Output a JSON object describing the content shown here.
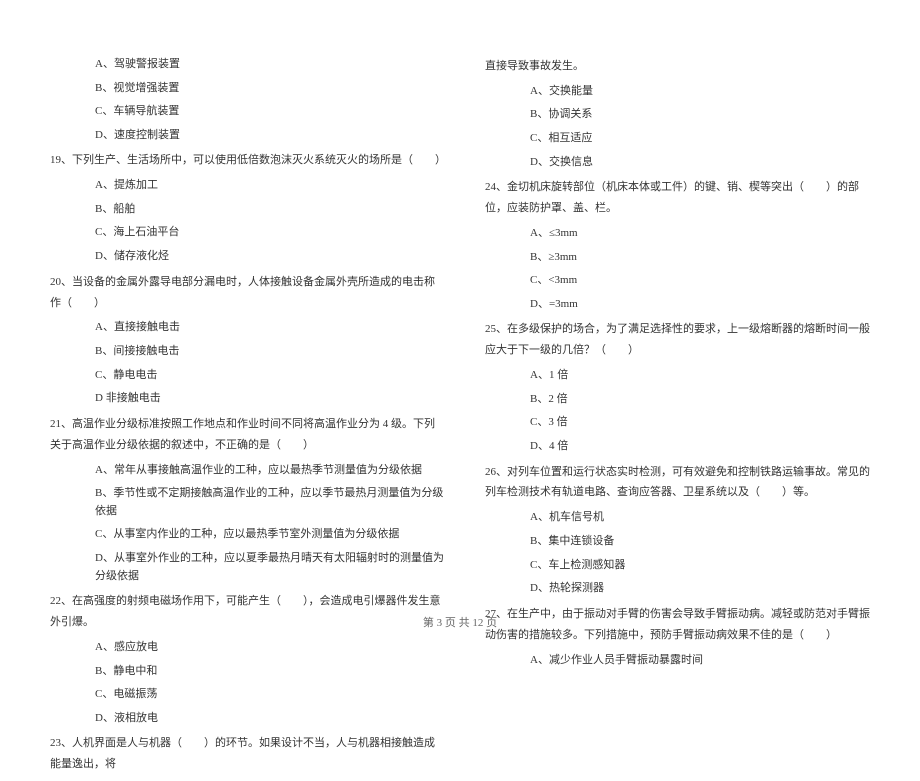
{
  "left": {
    "q18_options": {
      "a": "A、驾驶警报装置",
      "b": "B、视觉增强装置",
      "c": "C、车辆导航装置",
      "d": "D、速度控制装置"
    },
    "q19": {
      "text": "19、下列生产、生活场所中，可以使用低倍数泡沫灭火系统灭火的场所是（　　）",
      "a": "A、提炼加工",
      "b": "B、船舶",
      "c": "C、海上石油平台",
      "d": "D、储存液化烃"
    },
    "q20": {
      "text": "20、当设备的金属外露导电部分漏电时，人体接触设备金属外壳所造成的电击称作（　　）",
      "a": "A、直接接触电击",
      "b": "B、间接接触电击",
      "c": "C、静电电击",
      "d": "D 非接触电击"
    },
    "q21": {
      "text": "21、高温作业分级标准按照工作地点和作业时间不同将高温作业分为 4 级。下列关于高温作业分级依据的叙述中，不正确的是（　　）",
      "a": "A、常年从事接触高温作业的工种，应以最热季节测量值为分级依据",
      "b": "B、季节性或不定期接触高温作业的工种，应以季节最热月测量值为分级依据",
      "c": "C、从事室内作业的工种，应以最热季节室外测量值为分级依据",
      "d": "D、从事室外作业的工种，应以夏季最热月晴天有太阳辐射时的测量值为分级依据"
    },
    "q22": {
      "text": "22、在高强度的射频电磁场作用下，可能产生（　　），会造成电引爆器件发生意外引爆。",
      "a": "A、感应放电",
      "b": "B、静电中和",
      "c": "C、电磁振荡",
      "d": "D、液相放电"
    },
    "q23": {
      "text": "23、人机界面是人与机器（　　）的环节。如果设计不当，人与机器相接触造成能量逸出，将"
    }
  },
  "right": {
    "q23_cont": {
      "text": "直接导致事故发生。",
      "a": "A、交换能量",
      "b": "B、协调关系",
      "c": "C、相互适应",
      "d": "D、交换信息"
    },
    "q24": {
      "text": "24、金切机床旋转部位（机床本体或工件）的键、销、楔等突出（　　）的部位，应装防护罩、盖、栏。",
      "a": "A、≤3mm",
      "b": "B、≥3mm",
      "c": "C、<3mm",
      "d": "D、=3mm"
    },
    "q25": {
      "text": "25、在多级保护的场合，为了满足选择性的要求，上一级熔断器的熔断时间一般应大于下一级的几倍？（　　）",
      "a": "A、1 倍",
      "b": "B、2 倍",
      "c": "C、3 倍",
      "d": "D、4 倍"
    },
    "q26": {
      "text": "26、对列车位置和运行状态实时检测，可有效避免和控制铁路运输事故。常见的列车检测技术有轨道电路、查询应答器、卫星系统以及（　　）等。",
      "a": "A、机车信号机",
      "b": "B、集中连锁设备",
      "c": "C、车上检测感知器",
      "d": "D、热轮探测器"
    },
    "q27": {
      "text": "27、在生产中，由于振动对手臂的伤害会导致手臂振动病。减轻或防范对手臂振动伤害的措施较多。下列措施中，预防手臂振动病效果不佳的是（　　）",
      "a": "A、减少作业人员手臂振动暴露时间"
    }
  },
  "footer": "第 3 页 共 12 页"
}
